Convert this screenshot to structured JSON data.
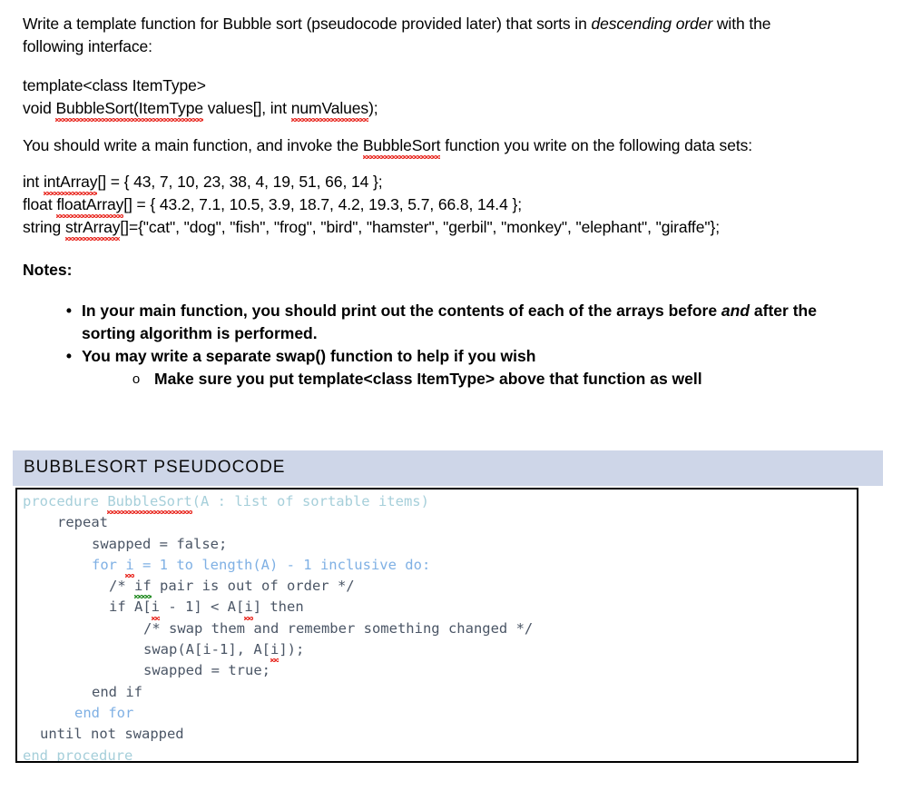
{
  "document": {
    "intro": {
      "line_a_pre": "Write a template function for Bubble sort (pseudocode provided later) that sorts in ",
      "line_a_em": "descending order",
      "line_a_post": " with the",
      "line_b": "following interface:"
    },
    "signature": {
      "line1": "template<class ItemType>",
      "line2_pre": "void ",
      "line2_sq1": "BubbleSort(ItemType",
      "line2_mid": " values[], int ",
      "line2_sq2": "numValues",
      "line2_post": ");"
    },
    "invoke_para": {
      "pre": "You should write a main function, and invoke the ",
      "sq": "BubbleSort",
      "post": " function you write on the following data sets:"
    },
    "data_sets": {
      "int_pre": "int ",
      "int_sq": "intArray",
      "int_post": "[] = { 43, 7, 10, 23, 38, 4, 19, 51, 66, 14 };",
      "float_pre": "float ",
      "float_sq": "floatArray",
      "float_post": "[] = { 43.2, 7.1, 10.5, 3.9, 18.7, 4.2, 19.3, 5.7, 66.8, 14.4 };",
      "string_pre": "string ",
      "string_sq": "strArray",
      "string_post": "[]={\"cat\", \"dog\", \"fish\", \"frog\", \"bird\", \"hamster\", \"gerbil\", \"monkey\", \"elephant\", \"giraffe\"};"
    },
    "notes_label": "Notes:",
    "bullets": [
      {
        "marker": "•",
        "level": 1,
        "pre": "In your main function, you should print out the contents of each of the arrays before ",
        "em": "and",
        "post": " after the sorting algorithm is performed."
      },
      {
        "marker": "•",
        "level": 1,
        "pre": "You may write a separate swap() function to help if you wish",
        "em": "",
        "post": ""
      },
      {
        "marker": "o",
        "level": 2,
        "pre": "Make sure you put template<class ItemType> above that function as well",
        "em": "",
        "post": ""
      }
    ],
    "pseudocode": {
      "header": "BUBBLESORT PSEUDOCODE",
      "header_bg": "#ced6e8",
      "border_color": "#000000",
      "colors": {
        "keyword_teal": "#a6cfda",
        "keyword_blue": "#7fb0e4",
        "body_text": "#4b5666"
      },
      "lines": [
        {
          "indent": 0,
          "segments": [
            {
              "text": "procedure ",
              "style": "teal"
            },
            {
              "text": "BubbleSort",
              "style": "teal",
              "spell": true
            },
            {
              "text": "(A : list of sortable items)",
              "style": "teal"
            }
          ]
        },
        {
          "indent": 1,
          "segments": [
            {
              "text": "repeat",
              "style": "dark"
            }
          ]
        },
        {
          "indent": 2,
          "segments": [
            {
              "text": "swapped = false;",
              "style": "dark"
            }
          ]
        },
        {
          "indent": 2,
          "segments": [
            {
              "text": "for ",
              "style": "blue"
            },
            {
              "text": "i",
              "style": "blue",
              "spell": true
            },
            {
              "text": " = 1 to length(A) - 1 inclusive do:",
              "style": "blue"
            }
          ]
        },
        {
          "indent": 3,
          "segments": [
            {
              "text": "/* ",
              "style": "dark"
            },
            {
              "text": "if",
              "style": "dark",
              "grammar": true
            },
            {
              "text": " pair is out of order */",
              "style": "dark"
            }
          ]
        },
        {
          "indent": 3,
          "segments": [
            {
              "text": "if A[",
              "style": "dark"
            },
            {
              "text": "i",
              "style": "dark",
              "spell": true
            },
            {
              "text": " - 1] < A[",
              "style": "dark"
            },
            {
              "text": "i",
              "style": "dark",
              "spell": true
            },
            {
              "text": "] then",
              "style": "dark"
            }
          ]
        },
        {
          "indent": 4,
          "segments": [
            {
              "text": "/* swap them and remember something changed */",
              "style": "dark"
            }
          ]
        },
        {
          "indent": 4,
          "segments": [
            {
              "text": "swap(A[i-1], A[",
              "style": "dark"
            },
            {
              "text": "i",
              "style": "dark",
              "spell": true
            },
            {
              "text": "]);",
              "style": "dark"
            }
          ]
        },
        {
          "indent": 4,
          "segments": [
            {
              "text": "swapped = true;",
              "style": "dark"
            }
          ]
        },
        {
          "indent": 3,
          "segments": [
            {
              "text": "end if",
              "style": "dark"
            }
          ],
          "pad": "endif"
        },
        {
          "indent": 2,
          "segments": [
            {
              "text": "end for",
              "style": "blue"
            }
          ],
          "pad": "endfor"
        },
        {
          "indent": 1,
          "segments": [
            {
              "text": "until not swapped",
              "style": "dark"
            }
          ],
          "pad": "until"
        },
        {
          "indent": 0,
          "segments": [
            {
              "text": "end procedure",
              "style": "teal"
            }
          ]
        }
      ]
    }
  }
}
